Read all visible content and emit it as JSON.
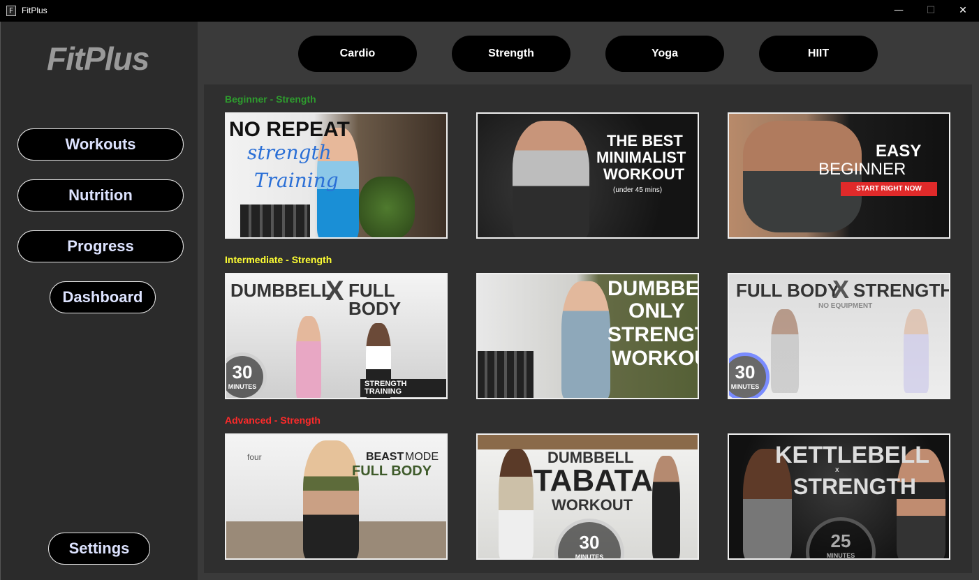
{
  "window": {
    "title": "FitPlus",
    "controls": {
      "minimize": "—",
      "maximize": "☐",
      "close": "✕"
    }
  },
  "sidebar": {
    "logo": "FitPlus",
    "nav": {
      "workouts": "Workouts",
      "nutrition": "Nutrition",
      "progress": "Progress",
      "dashboard": "Dashboard",
      "settings": "Settings"
    }
  },
  "categories": {
    "cardio": "Cardio",
    "strength": "Strength",
    "yoga": "Yoga",
    "hiit": "HIIT"
  },
  "sections": {
    "beginner": "Beginner - Strength",
    "intermediate": "Intermediate - Strength",
    "advanced": "Advanced - Strength"
  },
  "videos": {
    "b1": {
      "line1": "NO REPEAT",
      "line2": "strength",
      "line3": "Training"
    },
    "b2": {
      "line1": "THE BEST",
      "line2": "MINIMALIST",
      "line3": "WORKOUT",
      "sub": "(under 45 mins)"
    },
    "b3": {
      "line1": "EASY",
      "line2": "BEGINNER",
      "cta": "START RIGHT NOW"
    },
    "i1": {
      "line1": "DUMBBELL",
      "x": "X",
      "line2": "FULL BODY",
      "num": "30",
      "unit": "MINUTES",
      "tag": "STRENGTH TRAINING"
    },
    "i2": {
      "line1": "DUMBBELL",
      "line2": "ONLY",
      "line3": "STRENGTH",
      "line4": "WORKOUT"
    },
    "i3": {
      "line1": "FULL BODY",
      "x": "X",
      "line2": "STRENGTH",
      "sub": "NO EQUIPMENT",
      "num": "30",
      "unit": "MINUTES"
    },
    "a1": {
      "brand": "four",
      "line1a": "BEAST",
      "line1b": "MODE",
      "line2": "FULL BODY"
    },
    "a2": {
      "line1": "DUMBBELL",
      "line2": "TABATA",
      "line3": "WORKOUT",
      "num": "30",
      "unit": "MINUTES"
    },
    "a3": {
      "line1": "KETTLEBELL",
      "sep": "x",
      "line2": "STRENGTH",
      "num": "25",
      "unit": "MINUTES"
    }
  },
  "colors": {
    "beginner": "#2e9b2e",
    "intermediate": "#ffff33",
    "advanced": "#ff2a2a",
    "sidebar_bg": "#2b2b2b",
    "main_bg": "#3a3a3a"
  },
  "icons": {
    "app": "app-icon"
  }
}
